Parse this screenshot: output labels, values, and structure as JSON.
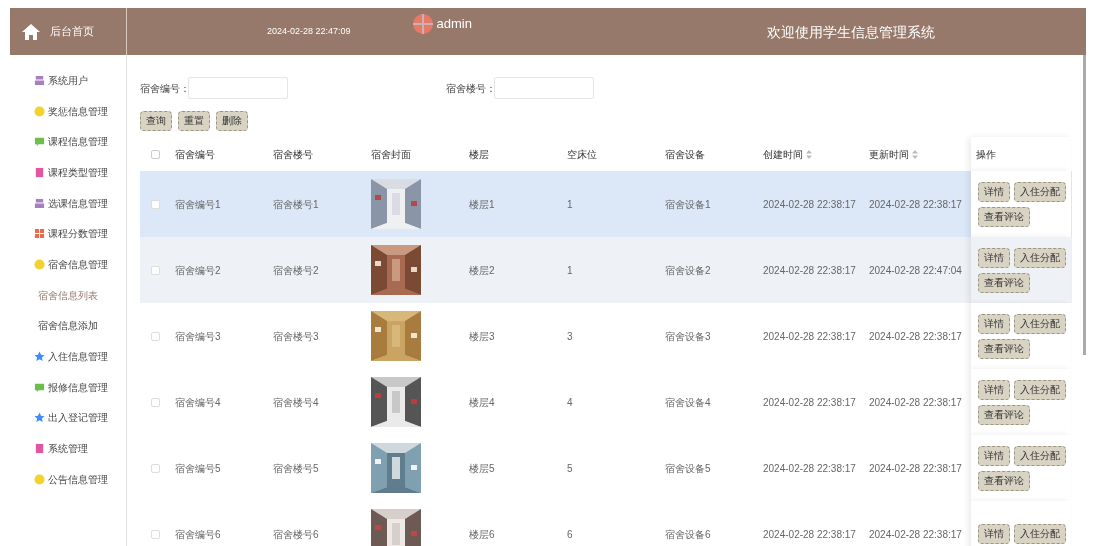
{
  "header": {
    "home_label": "后台首页",
    "datetime": "2024-02-28 22:47:09",
    "user": "admin",
    "title": "欢迎使用学生信息管理系统"
  },
  "sidebar": {
    "items": [
      {
        "label": "系统用户",
        "kind": "box",
        "color": "#a77fbf",
        "selected": false
      },
      {
        "label": "奖惩信息管理",
        "kind": "badge",
        "color": "#f2d22e",
        "selected": false
      },
      {
        "label": "课程信息管理",
        "kind": "chat",
        "color": "#6cbf4a",
        "selected": false
      },
      {
        "label": "课程类型管理",
        "kind": "doc",
        "color": "#e056a0",
        "selected": false
      },
      {
        "label": "选课信息管理",
        "kind": "box",
        "color": "#a77fbf",
        "selected": false
      },
      {
        "label": "课程分数管理",
        "kind": "grid",
        "color": "#e86a4f",
        "selected": false
      },
      {
        "label": "宿舍信息管理",
        "kind": "badge",
        "color": "#f2d22e",
        "selected": false
      },
      {
        "label": "宿舍信息列表",
        "kind": "subitem",
        "selected": true
      },
      {
        "label": "宿舍信息添加",
        "kind": "subitem",
        "selected": false
      },
      {
        "label": "入住信息管理",
        "kind": "star",
        "color": "#3e8ef7",
        "selected": false
      },
      {
        "label": "报修信息管理",
        "kind": "chat",
        "color": "#6cbf4a",
        "selected": false
      },
      {
        "label": "出入登记管理",
        "kind": "star",
        "color": "#3e8ef7",
        "selected": false
      },
      {
        "label": "系统管理",
        "kind": "doc",
        "color": "#e056a0",
        "selected": false
      },
      {
        "label": "公告信息管理",
        "kind": "badge",
        "color": "#f2d22e",
        "selected": false
      }
    ]
  },
  "search": {
    "fields": [
      {
        "label": "宿舍编号："
      },
      {
        "label": "宿舍楼号："
      }
    ],
    "buttons": [
      "查询",
      "重置",
      "删除"
    ]
  },
  "table": {
    "select_all": {
      "checked": false
    },
    "columns": [
      {
        "label": "宿舍编号",
        "sortable": false
      },
      {
        "label": "宿舍楼号",
        "sortable": false
      },
      {
        "label": "宿舍封面",
        "sortable": false
      },
      {
        "label": "楼层",
        "sortable": false
      },
      {
        "label": "空床位",
        "sortable": false
      },
      {
        "label": "宿舍设备",
        "sortable": false
      },
      {
        "label": "创建时间",
        "sortable": true
      },
      {
        "label": "更新时间",
        "sortable": true
      },
      {
        "label": "操作",
        "sortable": false
      }
    ],
    "rows": [
      {
        "selected": true,
        "hovered": false,
        "checked": false,
        "cells": [
          "宿舍编号1",
          "宿舍楼号1",
          {
            "kind": "picture"
          },
          "楼层1",
          "1",
          "宿舍设备1",
          "2024-02-28 22:38:17",
          "2024-02-28 22:38:17",
          {
            "actions": [
              "详情",
              "入住分配",
              "查看评论"
            ]
          }
        ]
      },
      {
        "selected": false,
        "hovered": true,
        "checked": false,
        "cells": [
          "宿舍编号2",
          "宿舍楼号2",
          {
            "kind": "picture"
          },
          "楼层2",
          "1",
          "宿舍设备2",
          "2024-02-28 22:38:17",
          "2024-02-28 22:47:04",
          {
            "actions": [
              "详情",
              "入住分配",
              "查看评论"
            ]
          }
        ]
      },
      {
        "selected": false,
        "hovered": false,
        "checked": false,
        "cells": [
          "宿舍编号3",
          "宿舍楼号3",
          {
            "kind": "picture"
          },
          "楼层3",
          "3",
          "宿舍设备3",
          "2024-02-28 22:38:17",
          "2024-02-28 22:38:17",
          {
            "actions": [
              "详情",
              "入住分配",
              "查看评论"
            ]
          }
        ]
      },
      {
        "selected": false,
        "hovered": false,
        "checked": false,
        "cells": [
          "宿舍编号4",
          "宿舍楼号4",
          {
            "kind": "picture"
          },
          "楼层4",
          "4",
          "宿舍设备4",
          "2024-02-28 22:38:17",
          "2024-02-28 22:38:17",
          {
            "actions": [
              "详情",
              "入住分配",
              "查看评论"
            ]
          }
        ]
      },
      {
        "selected": false,
        "hovered": false,
        "checked": false,
        "cells": [
          "宿舍编号5",
          "宿舍楼号5",
          {
            "kind": "picture"
          },
          "楼层5",
          "5",
          "宿舍设备5",
          "2024-02-28 22:38:17",
          "2024-02-28 22:38:17",
          {
            "actions": [
              "详情",
              "入住分配",
              "查看评论"
            ]
          }
        ]
      },
      {
        "selected": false,
        "hovered": false,
        "checked": false,
        "cells": [
          "宿舍编号6",
          "宿舍楼号6",
          {
            "kind": "picture"
          },
          "楼层6",
          "6",
          "宿舍设备6",
          "2024-02-28 22:38:17",
          "2024-02-28 22:38:17",
          {
            "actions": [
              "详情",
              "入住分配"
            ]
          }
        ]
      }
    ]
  }
}
